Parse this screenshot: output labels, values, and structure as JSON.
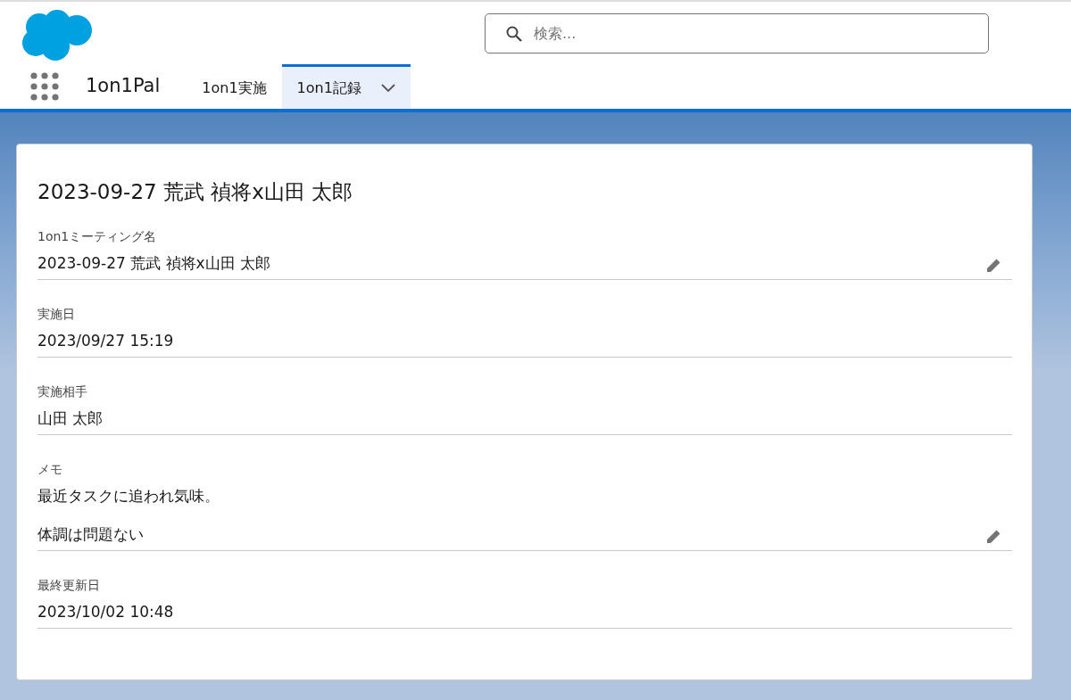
{
  "search": {
    "placeholder": "検索..."
  },
  "app_name": "1on1Pal",
  "tabs": [
    {
      "label": "1on1実施",
      "selected": false,
      "has_menu": false
    },
    {
      "label": "1on1記録",
      "selected": true,
      "has_menu": true
    }
  ],
  "record": {
    "title": "2023-09-27 荒武 禎将x山田 太郎",
    "fields": [
      {
        "label": "1on1ミーティング名",
        "lines": [
          "2023-09-27 荒武 禎将x山田 太郎"
        ],
        "editable": true
      },
      {
        "label": "実施日",
        "lines": [
          "2023/09/27 15:19"
        ],
        "editable": false
      },
      {
        "label": "実施相手",
        "lines": [
          "山田 太郎"
        ],
        "editable": false
      },
      {
        "label": "メモ",
        "lines": [
          "最近タスクに追われ気味。",
          "体調は問題ない"
        ],
        "editable": true
      },
      {
        "label": "最終更新日",
        "lines": [
          "2023/10/02 10:48"
        ],
        "editable": false
      }
    ]
  }
}
